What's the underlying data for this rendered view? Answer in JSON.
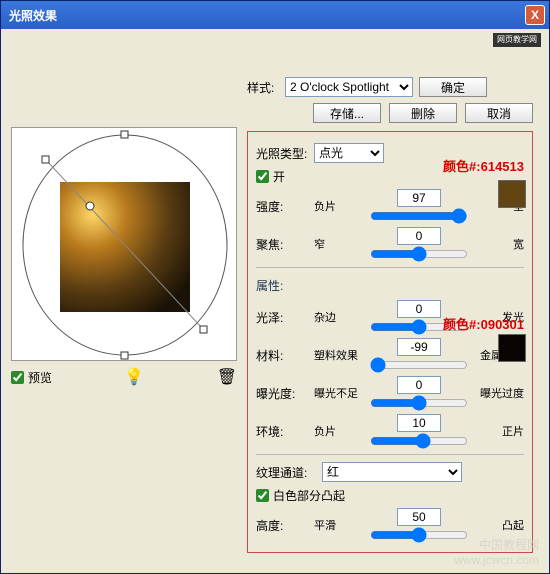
{
  "window": {
    "title": "光照效果",
    "close": "X"
  },
  "logo": "网页教学网",
  "style": {
    "label": "样式:",
    "selected": "2 O'clock Spotlight",
    "save": "存储...",
    "delete": "删除",
    "ok": "确定",
    "cancel": "取消"
  },
  "preview": {
    "label": "预览"
  },
  "light": {
    "type_label": "光照类型:",
    "type_value": "点光",
    "on": "开",
    "intensity": {
      "label": "强度:",
      "left": "负片",
      "right": "全",
      "value": "97"
    },
    "focus": {
      "label": "聚焦:",
      "left": "窄",
      "right": "宽",
      "value": "0"
    },
    "annot1": "颜色#:614513",
    "swatch1": "#614513"
  },
  "props": {
    "title": "属性:",
    "gloss": {
      "label": "光泽:",
      "left": "杂边",
      "right": "发光",
      "value": "0"
    },
    "material": {
      "label": "材料:",
      "left": "塑料效果",
      "right": "金属质感",
      "value": "-99"
    },
    "exposure": {
      "label": "曝光度:",
      "left": "曝光不足",
      "right": "曝光过度",
      "value": "0"
    },
    "ambient": {
      "label": "环境:",
      "left": "负片",
      "right": "正片",
      "value": "10"
    },
    "annot2": "颜色#:090301",
    "swatch2": "#090301"
  },
  "texture": {
    "label": "纹理通道:",
    "value": "红",
    "white": "白色部分凸起",
    "height": {
      "label": "高度:",
      "left": "平滑",
      "right": "凸起",
      "value": "50"
    }
  },
  "watermark": {
    "line1": "中国教程网",
    "line2": "www.jcwcn.com"
  }
}
